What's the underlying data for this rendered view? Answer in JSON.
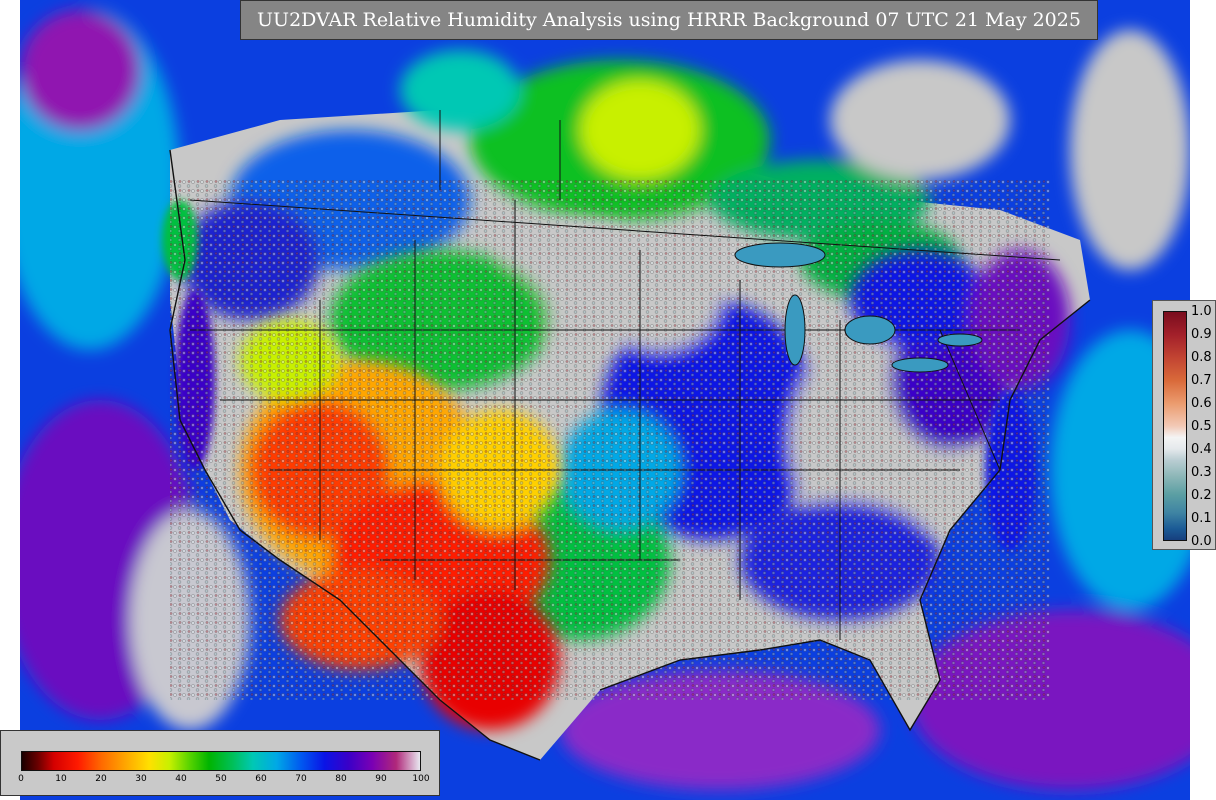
{
  "title": "UU2DVAR Relative Humidity Analysis using HRRR Background 07 UTC 21 May 2025",
  "observation_legend": {
    "ticks": [
      "1.0",
      "0.9",
      "0.8",
      "0.7",
      "0.6",
      "0.5",
      "0.4",
      "0.3",
      "0.2",
      "0.1",
      "0.0"
    ]
  },
  "rh_colorbar": {
    "ticks": [
      "0",
      "10",
      "20",
      "30",
      "40",
      "50",
      "60",
      "70",
      "80",
      "90",
      "100"
    ]
  },
  "colors": {
    "ocean_blue": "#0b3fe0",
    "dry_red": "#ff1a00",
    "land_gray": "#c8c8c8",
    "moist_purple": "#7a00b4"
  }
}
